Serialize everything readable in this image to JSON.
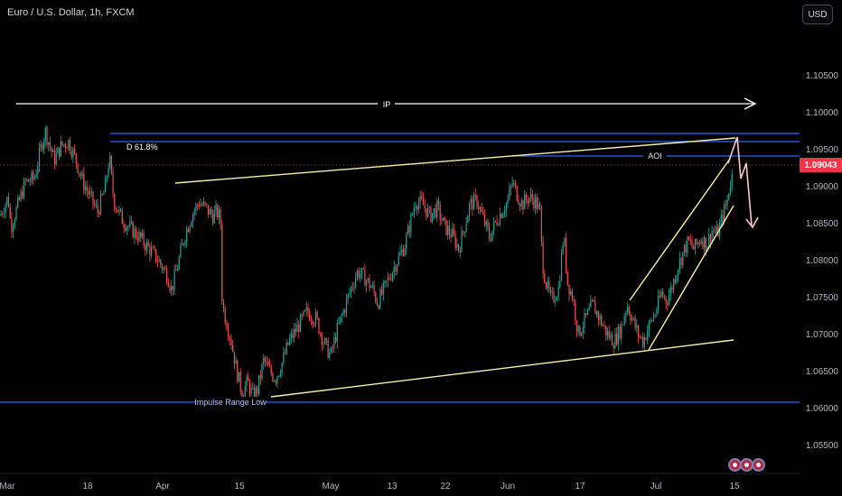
{
  "header": {
    "title": "Euro / U.S. Dollar, 1h, FXCM",
    "currency": "USD"
  },
  "current_price": "1.09043",
  "chart_data": {
    "type": "candlestick",
    "instrument": "Euro / U.S. Dollar",
    "timeframe": "1h",
    "source": "FXCM",
    "ylim": [
      1.0515,
      1.1115
    ],
    "y_ticks": [
      "1.10500",
      "1.10000",
      "1.09500",
      "1.09000",
      "1.08500",
      "1.08000",
      "1.07500",
      "1.07000",
      "1.06500",
      "1.06000",
      "1.05500"
    ],
    "x_ticks": [
      "Mar",
      "18",
      "Apr",
      "15",
      "May",
      "13",
      "22",
      "Jun",
      "17",
      "Jul",
      "15"
    ],
    "colors": {
      "up": "#26a69a",
      "down": "#ef5350"
    },
    "price_path": [
      [
        "Mar",
        1.086
      ],
      [
        9,
        1.0885
      ],
      [
        12,
        1.0845
      ],
      [
        20,
        1.0875
      ],
      [
        28,
        1.0905
      ],
      [
        38,
        1.091
      ],
      [
        45,
        1.095
      ],
      [
        50,
        1.0975
      ],
      [
        55,
        1.0955
      ],
      [
        60,
        1.0935
      ],
      [
        68,
        1.0955
      ],
      [
        76,
        1.096
      ],
      [
        84,
        1.0935
      ],
      [
        92,
        1.0905
      ],
      [
        100,
        1.0885
      ],
      [
        108,
        1.0865
      ],
      [
        116,
        1.0895
      ],
      [
        121,
        1.094
      ],
      [
        126,
        1.088
      ],
      [
        135,
        1.0855
      ],
      [
        145,
        1.0842
      ],
      [
        155,
        1.083
      ],
      [
        165,
        1.0815
      ],
      [
        175,
        1.08
      ],
      [
        185,
        1.078
      ],
      [
        190,
        1.076
      ],
      [
        198,
        1.08
      ],
      [
        205,
        1.0835
      ],
      [
        212,
        1.086
      ],
      [
        220,
        1.0878
      ],
      [
        228,
        1.087
      ],
      [
        235,
        1.086
      ],
      [
        240,
        1.0865
      ],
      [
        244,
        1.0855
      ],
      [
        246,
        1.074
      ],
      [
        250,
        1.072
      ],
      [
        256,
        1.069
      ],
      [
        262,
        1.065
      ],
      [
        268,
        1.062
      ],
      [
        274,
        1.0635
      ],
      [
        280,
        1.0615
      ],
      [
        285,
        1.0625
      ],
      [
        292,
        1.0665
      ],
      [
        298,
        1.065
      ],
      [
        305,
        1.064
      ],
      [
        312,
        1.066
      ],
      [
        320,
        1.069
      ],
      [
        330,
        1.071
      ],
      [
        340,
        1.073
      ],
      [
        350,
        1.072
      ],
      [
        358,
        1.069
      ],
      [
        366,
        1.067
      ],
      [
        372,
        1.07
      ],
      [
        380,
        1.073
      ],
      [
        388,
        1.076
      ],
      [
        396,
        1.0785
      ],
      [
        404,
        1.0775
      ],
      [
        412,
        1.0762
      ],
      [
        418,
        1.0742
      ],
      [
        425,
        1.076
      ],
      [
        432,
        1.078
      ],
      [
        440,
        1.08
      ],
      [
        448,
        1.082
      ],
      [
        454,
        1.085
      ],
      [
        460,
        1.088
      ],
      [
        468,
        1.0875
      ],
      [
        476,
        1.086
      ],
      [
        484,
        1.087
      ],
      [
        492,
        1.0845
      ],
      [
        500,
        1.0835
      ],
      [
        508,
        1.0815
      ],
      [
        514,
        1.0845
      ],
      [
        520,
        1.0875
      ],
      [
        528,
        1.088
      ],
      [
        535,
        1.0855
      ],
      [
        542,
        1.083
      ],
      [
        548,
        1.085
      ],
      [
        555,
        1.0865
      ],
      [
        562,
        1.088
      ],
      [
        567,
        1.0905
      ],
      [
        572,
        1.089
      ],
      [
        578,
        1.0875
      ],
      [
        585,
        1.0885
      ],
      [
        592,
        1.088
      ],
      [
        598,
        1.0865
      ],
      [
        600,
        1.08
      ],
      [
        604,
        1.077
      ],
      [
        610,
        1.0745
      ],
      [
        618,
        1.076
      ],
      [
        624,
        1.0835
      ],
      [
        628,
        1.077
      ],
      [
        634,
        1.075
      ],
      [
        640,
        1.07
      ],
      [
        648,
        1.072
      ],
      [
        656,
        1.074
      ],
      [
        664,
        1.072
      ],
      [
        672,
        1.07
      ],
      [
        680,
        1.069
      ],
      [
        688,
        1.071
      ],
      [
        694,
        1.074
      ],
      [
        700,
        1.072
      ],
      [
        706,
        1.07
      ],
      [
        712,
        1.069
      ],
      [
        718,
        1.071
      ],
      [
        726,
        1.073
      ],
      [
        732,
        1.0755
      ],
      [
        738,
        1.0745
      ],
      [
        744,
        1.0765
      ],
      [
        750,
        1.079
      ],
      [
        756,
        1.081
      ],
      [
        762,
        1.0825
      ],
      [
        768,
        1.0815
      ],
      [
        776,
        1.083
      ],
      [
        782,
        1.082
      ],
      [
        788,
        1.084
      ],
      [
        794,
        1.0835
      ],
      [
        800,
        1.086
      ],
      [
        805,
        1.088
      ],
      [
        808,
        1.0905
      ],
      [
        811,
        1.0915
      ]
    ],
    "annotations": {
      "levels": [
        {
          "price": 1.0943,
          "color": "#2962ff"
        },
        {
          "price": 1.0933,
          "color": "#2962ff"
        },
        {
          "price": 1.0913,
          "color": "#2962ff",
          "label": "AOI"
        },
        {
          "price": 1.0602,
          "color": "#2962ff",
          "label": "Impulse Range Low"
        }
      ],
      "fib_label": "D 61.8%",
      "ip_label": "IP"
    }
  }
}
